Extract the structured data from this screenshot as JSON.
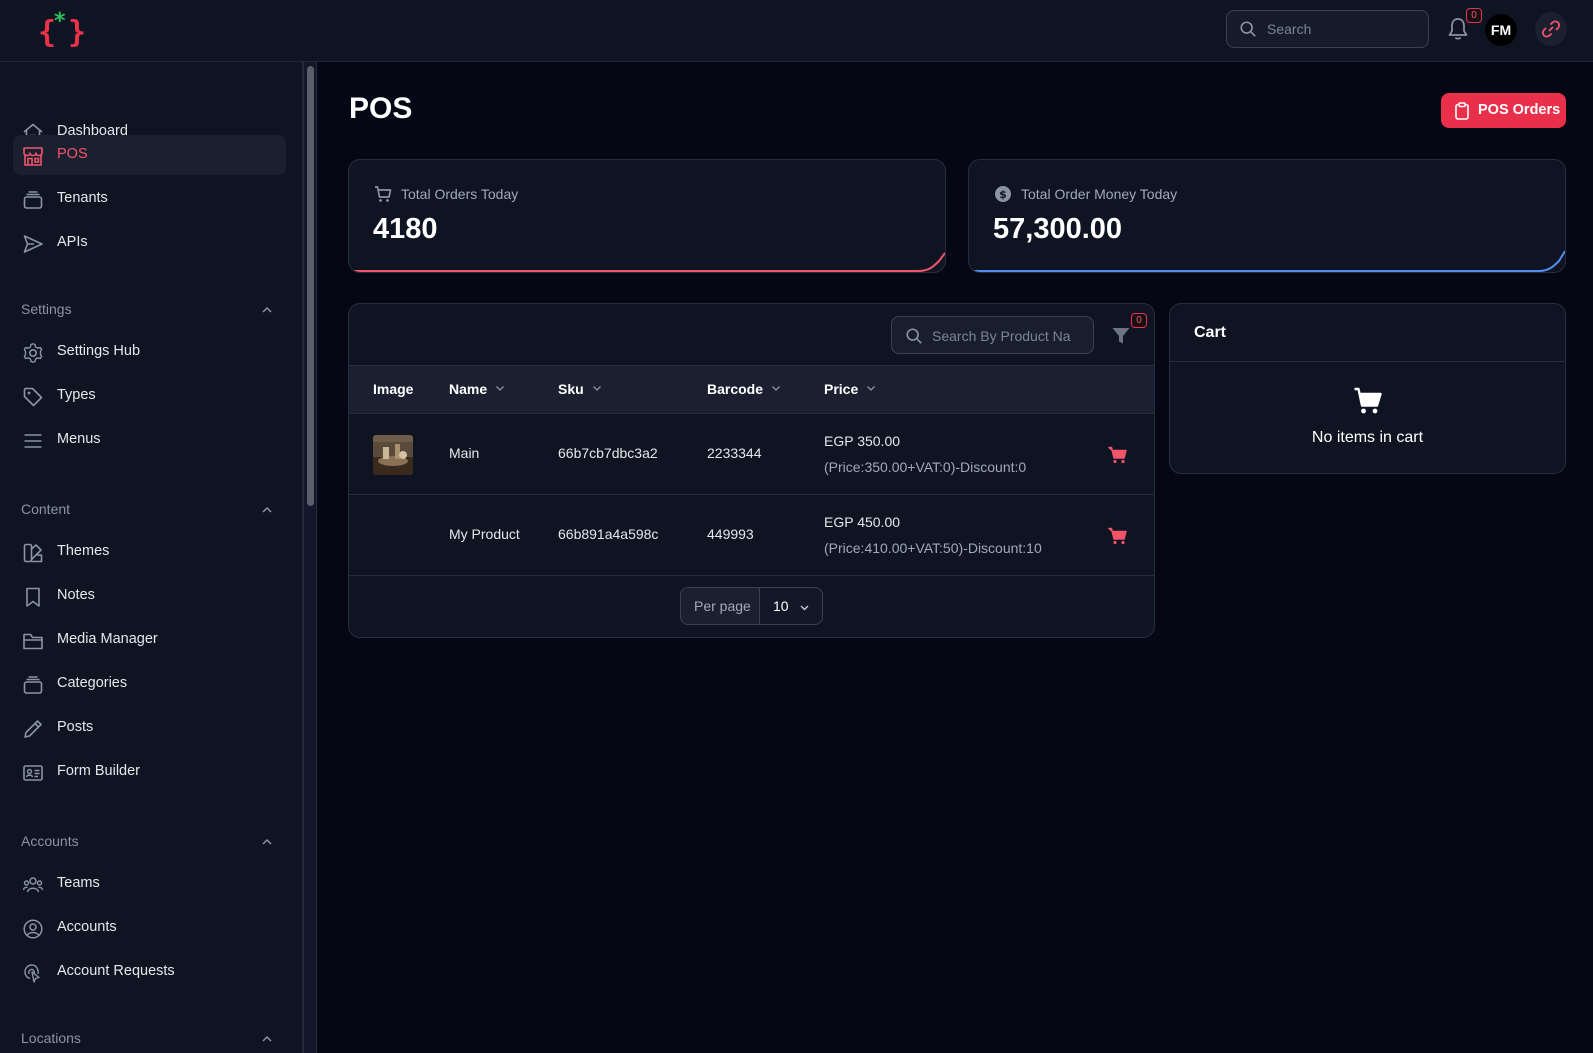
{
  "topbar": {
    "search_placeholder": "Search",
    "notification_count": "0",
    "avatar_initials": "FM"
  },
  "sidebar": {
    "items_main": [
      {
        "label": "Dashboard",
        "icon": "home-icon"
      },
      {
        "label": "POS",
        "icon": "store-icon",
        "active": true
      },
      {
        "label": "Tenants",
        "icon": "layers-icon"
      },
      {
        "label": "APIs",
        "icon": "send-icon"
      }
    ],
    "groups": {
      "settings": {
        "label": "Settings",
        "items": [
          {
            "label": "Settings Hub",
            "icon": "gear-icon"
          },
          {
            "label": "Types",
            "icon": "tag-icon"
          },
          {
            "label": "Menus",
            "icon": "menu-icon"
          }
        ]
      },
      "content": {
        "label": "Content",
        "items": [
          {
            "label": "Themes",
            "icon": "palette-icon"
          },
          {
            "label": "Notes",
            "icon": "bookmark-icon"
          },
          {
            "label": "Media Manager",
            "icon": "folder-icon"
          },
          {
            "label": "Categories",
            "icon": "layers-icon"
          },
          {
            "label": "Posts",
            "icon": "pencil-icon"
          },
          {
            "label": "Form Builder",
            "icon": "id-card-icon"
          }
        ]
      },
      "accounts": {
        "label": "Accounts",
        "items": [
          {
            "label": "Teams",
            "icon": "users-icon"
          },
          {
            "label": "Accounts",
            "icon": "user-circle-icon"
          },
          {
            "label": "Account Requests",
            "icon": "pointer-icon"
          }
        ]
      },
      "locations": {
        "label": "Locations"
      }
    }
  },
  "main": {
    "title": "POS",
    "pos_orders_label": "POS Orders",
    "stats": [
      {
        "label": "Total Orders Today",
        "value": "4180",
        "icon": "cart-icon",
        "accent": "#f2546a"
      },
      {
        "label": "Total Order Money Today",
        "value": "57,300.00",
        "icon": "dollar-icon",
        "accent": "#4f8ef0"
      }
    ],
    "product_table": {
      "search_placeholder": "Search By Product Na",
      "filter_count": "0",
      "columns": [
        "Image",
        "Name",
        "Sku",
        "Barcode",
        "Price"
      ],
      "rows": [
        {
          "name": "Main",
          "sku": "66b7cb7dbc3a2",
          "barcode": "2233344",
          "price": "EGP 350.00",
          "price_detail": "(Price:350.00+VAT:0)-Discount:0",
          "has_image": true
        },
        {
          "name": "My Product",
          "sku": "66b891a4a598c",
          "barcode": "449993",
          "price": "EGP 450.00",
          "price_detail": "(Price:410.00+VAT:50)-Discount:10",
          "has_image": false
        }
      ],
      "per_page_label": "Per page",
      "per_page_value": "10"
    },
    "cart": {
      "title": "Cart",
      "empty_text": "No items in cart"
    }
  },
  "colors": {
    "accent": "#ea2f4a",
    "background": "#050814",
    "panel": "#0f1422"
  }
}
